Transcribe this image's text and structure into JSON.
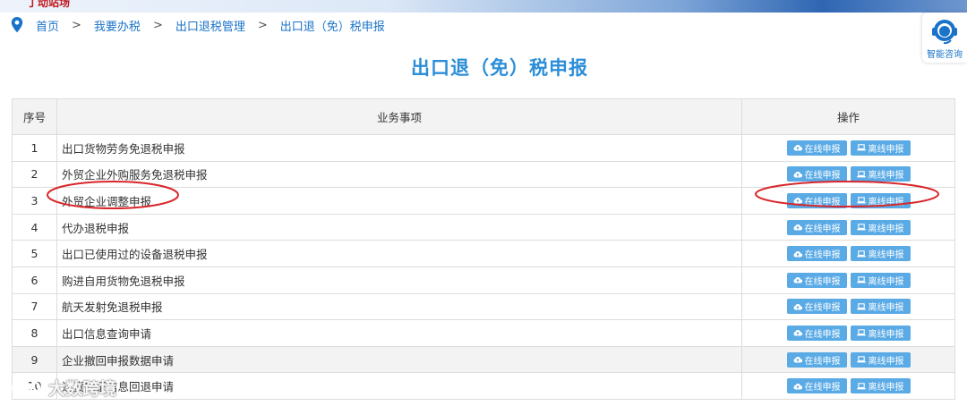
{
  "header": {
    "logo_text": "丁动站场"
  },
  "breadcrumb": {
    "items": [
      "首页",
      "我要办税",
      "出口退税管理",
      "出口退（免）税申报"
    ],
    "separator": ">"
  },
  "assistant": {
    "label": "智能咨询"
  },
  "page": {
    "title": "出口退（免）税申报"
  },
  "table": {
    "headers": {
      "index": "序号",
      "item": "业务事项",
      "ops": "操作"
    },
    "online_label": "在线申报",
    "offline_label": "离线申报",
    "rows": [
      {
        "index": "1",
        "name": "出口货物劳务免退税申报"
      },
      {
        "index": "2",
        "name": "外贸企业外购服务免退税申报"
      },
      {
        "index": "3",
        "name": "外贸企业调整申报"
      },
      {
        "index": "4",
        "name": "代办退税申报"
      },
      {
        "index": "5",
        "name": "出口已使用过的设备退税申报"
      },
      {
        "index": "6",
        "name": "购进自用货物免退税申报"
      },
      {
        "index": "7",
        "name": "航天发射免退税申报"
      },
      {
        "index": "8",
        "name": "出口信息查询申请"
      },
      {
        "index": "9",
        "name": "企业撤回申报数据申请"
      },
      {
        "index": "10",
        "name": "进货凭证信息回退申请"
      }
    ],
    "shaded_rows": [
      9
    ]
  },
  "watermark": {
    "text": "大数跨境"
  },
  "colors": {
    "link": "#1a73c8",
    "title": "#2b8ed8",
    "button": "#5aaae6",
    "annotation": "#d9262b"
  }
}
